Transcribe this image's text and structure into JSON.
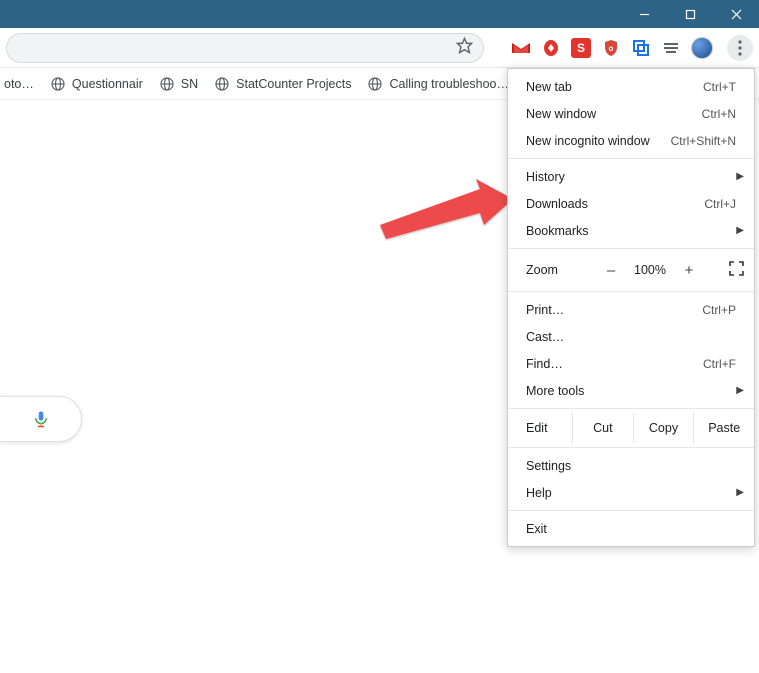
{
  "window": {
    "min": "—",
    "max": "▢",
    "close": "✕"
  },
  "bookmarks": {
    "items": [
      {
        "label": "oto…"
      },
      {
        "label": "Questionnair"
      },
      {
        "label": "SN"
      },
      {
        "label": "StatCounter Projects"
      },
      {
        "label": "Calling troubleshoo…"
      }
    ]
  },
  "menu": {
    "new_tab": {
      "label": "New tab",
      "shortcut": "Ctrl+T"
    },
    "new_window": {
      "label": "New window",
      "shortcut": "Ctrl+N"
    },
    "new_incognito": {
      "label": "New incognito window",
      "shortcut": "Ctrl+Shift+N"
    },
    "history": {
      "label": "History"
    },
    "downloads": {
      "label": "Downloads",
      "shortcut": "Ctrl+J"
    },
    "bookmarks": {
      "label": "Bookmarks"
    },
    "zoom": {
      "label": "Zoom",
      "minus": "–",
      "percent": "100%",
      "plus": "+"
    },
    "print": {
      "label": "Print…",
      "shortcut": "Ctrl+P"
    },
    "cast": {
      "label": "Cast…"
    },
    "find": {
      "label": "Find…",
      "shortcut": "Ctrl+F"
    },
    "more_tools": {
      "label": "More tools"
    },
    "edit": {
      "label": "Edit",
      "cut": "Cut",
      "copy": "Copy",
      "paste": "Paste"
    },
    "settings": {
      "label": "Settings"
    },
    "help": {
      "label": "Help"
    },
    "exit": {
      "label": "Exit"
    }
  }
}
